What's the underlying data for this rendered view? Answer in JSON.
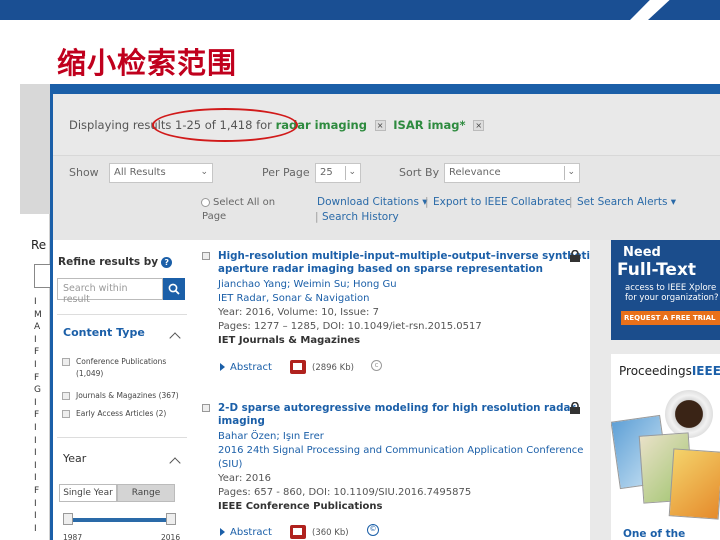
{
  "slide": {
    "title": "缩小检索范围"
  },
  "header": {
    "prefix": "Displaying results 1-25 of 1,418 for",
    "term1": "radar imaging",
    "term2": "ISAR imag*",
    "remove_glyph": "×"
  },
  "controls": {
    "show_label": "Show",
    "show_value": "All Results",
    "perpage_label": "Per Page",
    "perpage_value": "25",
    "sortby_label": "Sort By",
    "sortby_value": "Relevance",
    "select_all": "Select All on",
    "select_all_2": "Page",
    "download": "Download Citations ▾",
    "export": "Export to IEEE Collabratec",
    "alerts": "Set Search Alerts ▾",
    "history": "Search History",
    "pipe": "|"
  },
  "sidebar": {
    "refine": "Refine results by",
    "help_glyph": "?",
    "search_placeholder": "Search within result",
    "content_type": "Content Type",
    "facets": [
      {
        "label": "Conference Publications",
        "count": "(1,049)"
      },
      {
        "label": "Journals & Magazines (367)",
        "count": ""
      },
      {
        "label": "Early Access Articles (2)",
        "count": ""
      }
    ],
    "year": "Year",
    "single_year": "Single Year",
    "range": "Range",
    "year_from": "1987",
    "year_to": "2016"
  },
  "left_strip": {
    "re": "Re",
    "letters": "I\nM\nA\nI\nF\nI\nF\nG\nI\nF\nI\nI\nI\nI\nI\nF\nI\nI\nI"
  },
  "results": [
    {
      "title_1": "High-resolution multiple-input–multiple-output–inverse synthetic",
      "title_2": "aperture radar imaging based on sparse representation",
      "authors": "Jianchao Yang; Weimin Su; Hong Gu",
      "venue": "IET Radar, Sonar & Navigation",
      "meta": "Year: 2016, Volume: 10, Issue: 7",
      "pages": "Pages: 1277 – 1285, DOI: 10.1049/iet-rsn.2015.0517",
      "publisher": "IET Journals & Magazines",
      "abstract": "Abstract",
      "size": "(2896 Kb)",
      "cc": "c"
    },
    {
      "title_1": "2-D sparse autoregressive modeling for high resolution radar",
      "title_2": "imaging",
      "authors": "Bahar Özen; Işın Erer",
      "venue": "2016 24th Signal Processing and Communication Application Conference",
      "venue_2": "(SIU)",
      "meta": "Year: 2016",
      "pages": "Pages: 657 - 860, DOI: 10.1109/SIU.2016.7495875",
      "publisher": "IEEE Conference Publications",
      "abstract": "Abstract",
      "size": "(360 Kb)",
      "cc": "©"
    }
  ],
  "ads": {
    "need": "Need",
    "fulltext": "Full-Text",
    "access_1": "access to IEEE Xplore",
    "access_2": "for your organization?",
    "request": "REQUEST A FREE TRIAL",
    "proceedings": "Proceedings",
    "ieee": "IEEE",
    "one_of": "One of the"
  }
}
